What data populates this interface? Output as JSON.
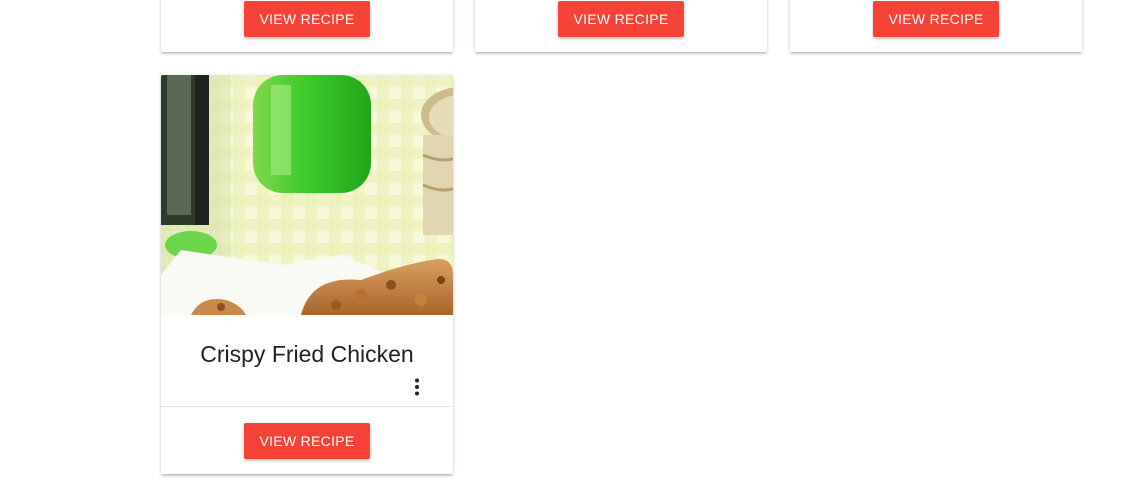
{
  "top_cards": [
    {
      "button_label": "VIEW RECIPE"
    },
    {
      "button_label": "VIEW RECIPE"
    },
    {
      "button_label": "VIEW RECIPE"
    }
  ],
  "recipe_card": {
    "title": "Crispy Fried Chicken",
    "button_label": "VIEW RECIPE",
    "menu_icon": "more-vert-icon",
    "image_icon": "fried-chicken-photo"
  },
  "colors": {
    "accent": "#f44336",
    "title_text": "#212121"
  }
}
